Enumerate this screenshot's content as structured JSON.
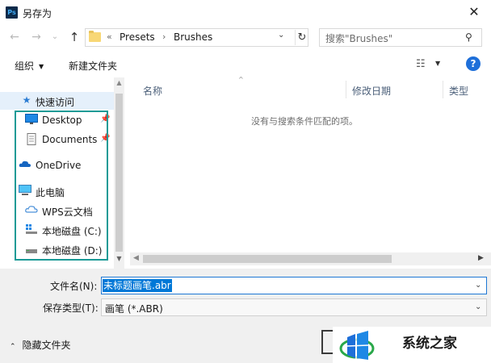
{
  "window": {
    "title": "另存为",
    "app_icon_text": "Ps",
    "close_glyph": "✕"
  },
  "nav": {
    "back_glyph": "←",
    "forward_glyph": "→",
    "recent_glyph": "⌄",
    "up_glyph": "↑",
    "breadcrumb": [
      "«",
      "Presets",
      "›",
      "Brushes"
    ],
    "search_placeholder": "搜索\"Brushes\"",
    "search_glyph": "⚲",
    "refresh_glyph": "↻",
    "dropdown_glyph": "⌄"
  },
  "toolbar": {
    "organize": "组织",
    "caret": "▼",
    "new_folder": "新建文件夹",
    "view_glyph": "☷",
    "help": "?"
  },
  "sidebar": {
    "quick_access": "快速访问",
    "items": [
      {
        "label": "Desktop",
        "icon": "desktop-icon",
        "pinned": true
      },
      {
        "label": "Documents",
        "icon": "document-icon",
        "pinned": true
      },
      {
        "label": "OneDrive",
        "icon": "cloud-icon",
        "pinned": false
      },
      {
        "label": "此电脑",
        "icon": "computer-icon",
        "pinned": false
      },
      {
        "label": "WPS云文档",
        "icon": "cloud-icon",
        "pinned": false
      },
      {
        "label": "本地磁盘 (C:)",
        "icon": "drive-icon",
        "pinned": false
      },
      {
        "label": "本地磁盘 (D:)",
        "icon": "drive-icon",
        "pinned": false
      }
    ],
    "pin_glyph": "📌"
  },
  "files": {
    "columns": [
      "名称",
      "修改日期",
      "类型"
    ],
    "empty_message": "没有与搜索条件匹配的项。"
  },
  "form": {
    "filename_label": "文件名(N):",
    "filename_value": "未标题画笔.abr",
    "filetype_label": "保存类型(T):",
    "filetype_value": "画笔 (*.ABR)",
    "hide_folders": "隐藏文件夹",
    "hide_caret": "⌃"
  },
  "watermark": {
    "text": "系统之家"
  },
  "colors": {
    "accent": "#0078d7",
    "highlight_box": "#1a9a96",
    "quick_access_bg": "#e5f0fb"
  }
}
